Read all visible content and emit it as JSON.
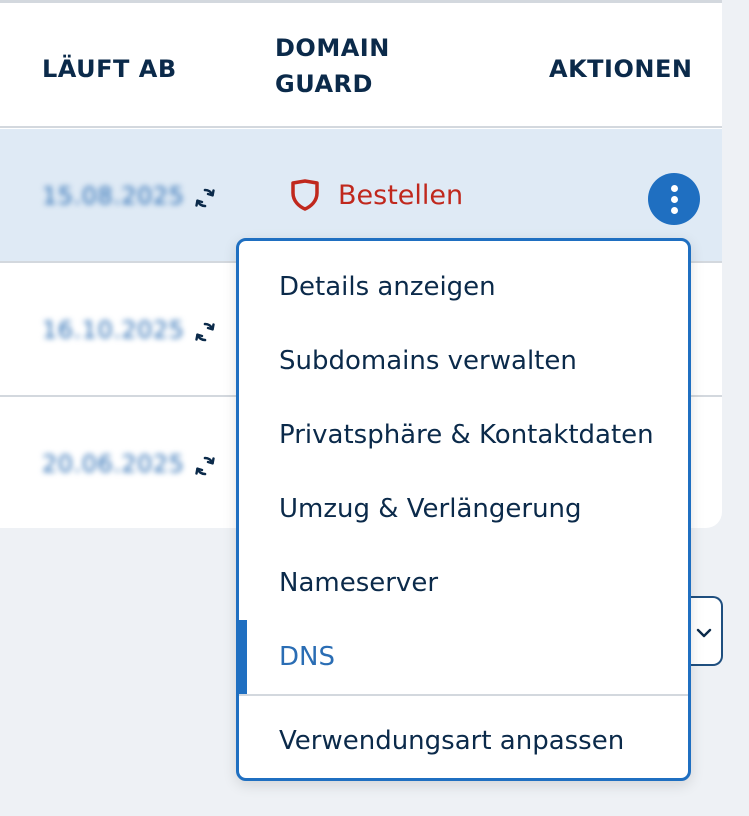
{
  "table": {
    "headers": {
      "expires": "LÄUFT AB",
      "guard_line1": "DOMAIN",
      "guard_line2": "GUARD",
      "actions": "AKTIONEN"
    },
    "rows": [
      {
        "expires": "15.08.2025",
        "guard_action": "Bestellen"
      },
      {
        "expires": "16.10.2025"
      },
      {
        "expires": "20.06.2025"
      }
    ]
  },
  "colors": {
    "accent": "#1f6fc1",
    "highlight_row": "#dfeaf5",
    "guard_red": "#c0281d",
    "text": "#0b2a4a"
  },
  "icons": {
    "renew": "renew-icon",
    "guard": "shield-icon",
    "actions": "more-vertical-icon",
    "select": "chevron-down-icon"
  },
  "menu": {
    "items": [
      "Details anzeigen",
      "Subdomains verwalten",
      "Privatsphäre & Kontaktdaten",
      "Umzug & Verlängerung",
      "Nameserver",
      "DNS",
      "Verwendungsart anpassen"
    ],
    "active_item": "DNS"
  }
}
